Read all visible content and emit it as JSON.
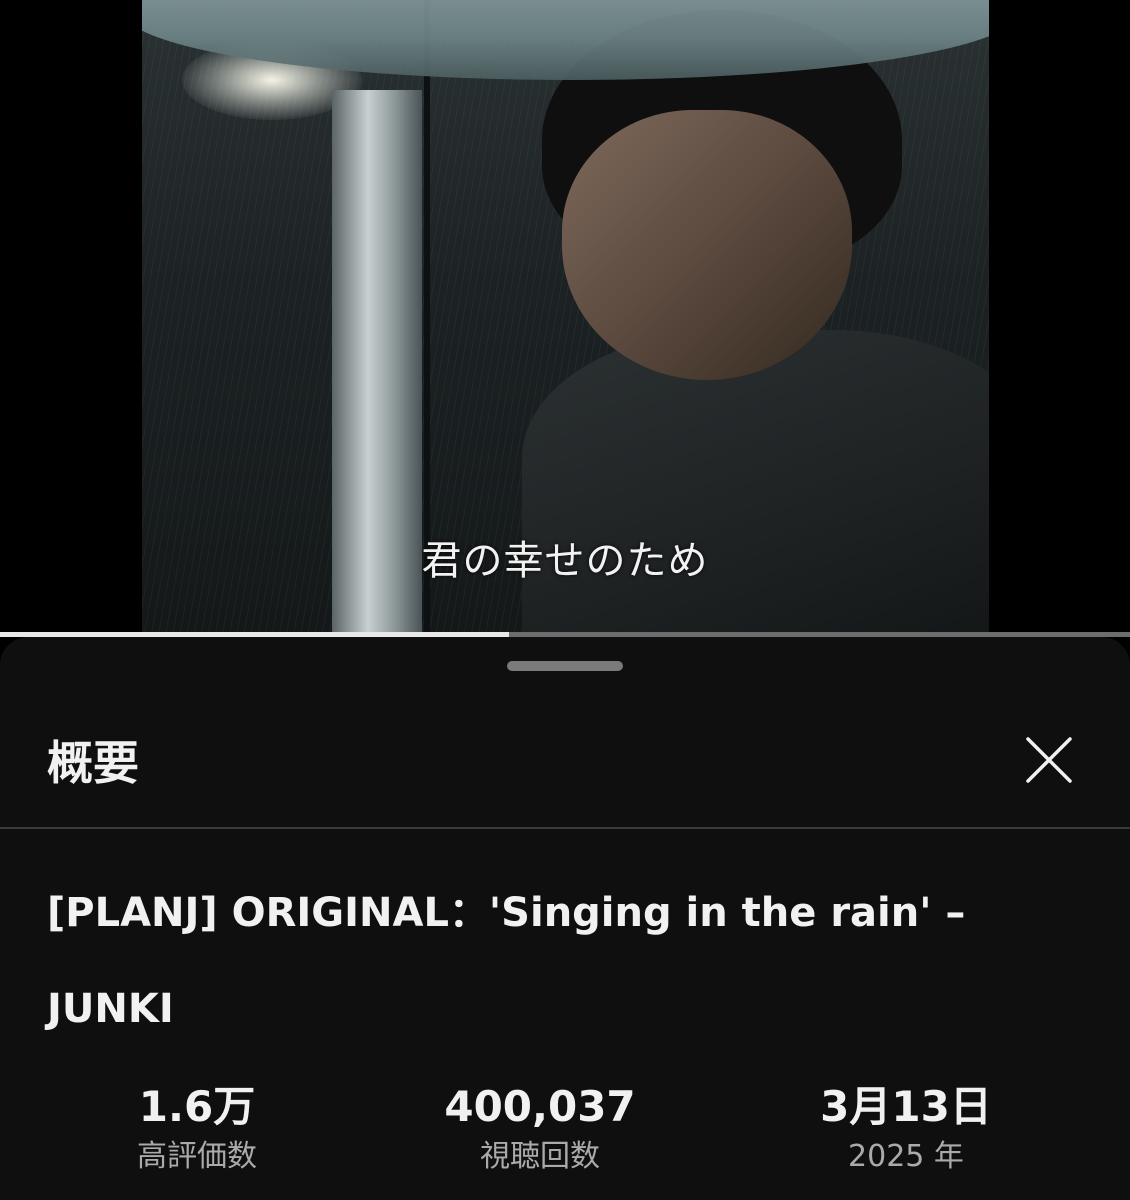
{
  "player": {
    "subtitle": "君の幸せのため",
    "progress": 0.45
  },
  "sheet": {
    "title": "概要",
    "close_icon": "close-icon"
  },
  "video": {
    "title": "[PLANJ] ORIGINAL：'Singing in the rain' – JUNKI"
  },
  "stats": {
    "likes": {
      "value": "1.6万",
      "label": "高評価数"
    },
    "views": {
      "value": "400,037",
      "label": "視聴回数"
    },
    "date": {
      "value": "3月13日",
      "label": "2025 年"
    }
  },
  "colors": {
    "background": "#0f0f0f",
    "progress_fill": "#e8e8e8",
    "progress_track": "#6d6d6d",
    "secondary_text": "#aaaaaa"
  }
}
